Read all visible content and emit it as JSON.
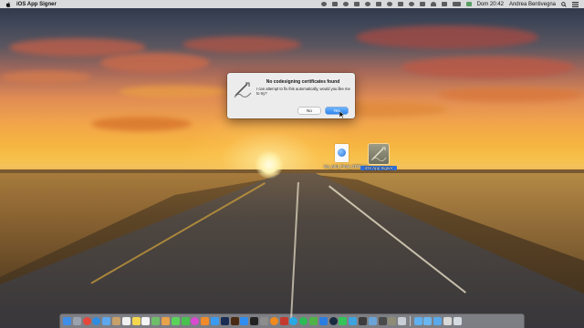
{
  "menubar": {
    "app_name": "iOS App Signer",
    "clock": "Dom 20:42",
    "user": "Andrea Bentivegna"
  },
  "dialog": {
    "title": "No codesigning certificates found",
    "message": "I can attempt to fix this automatically, would you like me to try?",
    "no_label": "No",
    "yes_label": "Yes"
  },
  "desktop_items": [
    {
      "label": "ios_and_Final_0155.ipa",
      "icon": "ipa-file-icon"
    },
    {
      "label": "iOS App Signer",
      "icon": "app-signer-icon"
    }
  ],
  "dock": {
    "icons": [
      {
        "name": "finder-icon",
        "color": "#3f8ee8"
      },
      {
        "name": "launchpad-icon",
        "color": "#9aa3ad"
      },
      {
        "name": "chrome-icon",
        "color": "#e4483b"
      },
      {
        "name": "safari-icon",
        "color": "#2f8ce0"
      },
      {
        "name": "mail-icon",
        "color": "#5da7ee"
      },
      {
        "name": "contacts-icon",
        "color": "#c8a16a"
      },
      {
        "name": "calendar-icon",
        "color": "#f1f1f1"
      },
      {
        "name": "notes-icon",
        "color": "#f5d74d"
      },
      {
        "name": "reminders-icon",
        "color": "#f4f4f4"
      },
      {
        "name": "maps-icon",
        "color": "#6fbf6a"
      },
      {
        "name": "photos-icon",
        "color": "#e8a24a"
      },
      {
        "name": "messages-icon",
        "color": "#5bd35a"
      },
      {
        "name": "facetime-icon",
        "color": "#49c14f"
      },
      {
        "name": "itunes-icon",
        "color": "#d84bd0"
      },
      {
        "name": "ibooks-icon",
        "color": "#f08a2b"
      },
      {
        "name": "app-store-icon",
        "color": "#3a9bf0"
      },
      {
        "name": "photoshop-icon",
        "color": "#1b2d52"
      },
      {
        "name": "illustrator-icon",
        "color": "#4a2a12"
      },
      {
        "name": "xcode-icon",
        "color": "#2f8cf0"
      },
      {
        "name": "terminal-icon",
        "color": "#222222"
      },
      {
        "name": "system-preferences-icon",
        "color": "#8d8d8d"
      },
      {
        "name": "vlc-icon",
        "color": "#f08a1c"
      },
      {
        "name": "filezilla-icon",
        "color": "#c43a2f"
      },
      {
        "name": "skype-icon",
        "color": "#27a9e6"
      },
      {
        "name": "spotify-icon",
        "color": "#2dbb55"
      },
      {
        "name": "evernote-icon",
        "color": "#4fb348"
      },
      {
        "name": "dropbox-icon",
        "color": "#2c7de0"
      },
      {
        "name": "steam-icon",
        "color": "#1a2a3f"
      },
      {
        "name": "whatsapp-icon",
        "color": "#34c45a"
      },
      {
        "name": "telegram-icon",
        "color": "#3ea3de"
      },
      {
        "name": "sublime-icon",
        "color": "#3d3d3d"
      },
      {
        "name": "preview-icon",
        "color": "#6aa3d8"
      },
      {
        "name": "simulator-icon",
        "color": "#4a4a4a"
      },
      {
        "name": "ios-app-signer-icon",
        "color": "#8e8c76"
      },
      {
        "name": "trash-icon",
        "color": "#c9ced6"
      }
    ],
    "right_icons": [
      {
        "name": "downloads-folder-icon",
        "color": "#5fb0ef"
      },
      {
        "name": "documents-folder-icon",
        "color": "#6ab6f0"
      },
      {
        "name": "applications-folder-icon",
        "color": "#5aa9ea"
      },
      {
        "name": "stack-icon",
        "color": "#d9d9d9"
      },
      {
        "name": "trash-bin-icon",
        "color": "#d6dbe2"
      }
    ]
  }
}
